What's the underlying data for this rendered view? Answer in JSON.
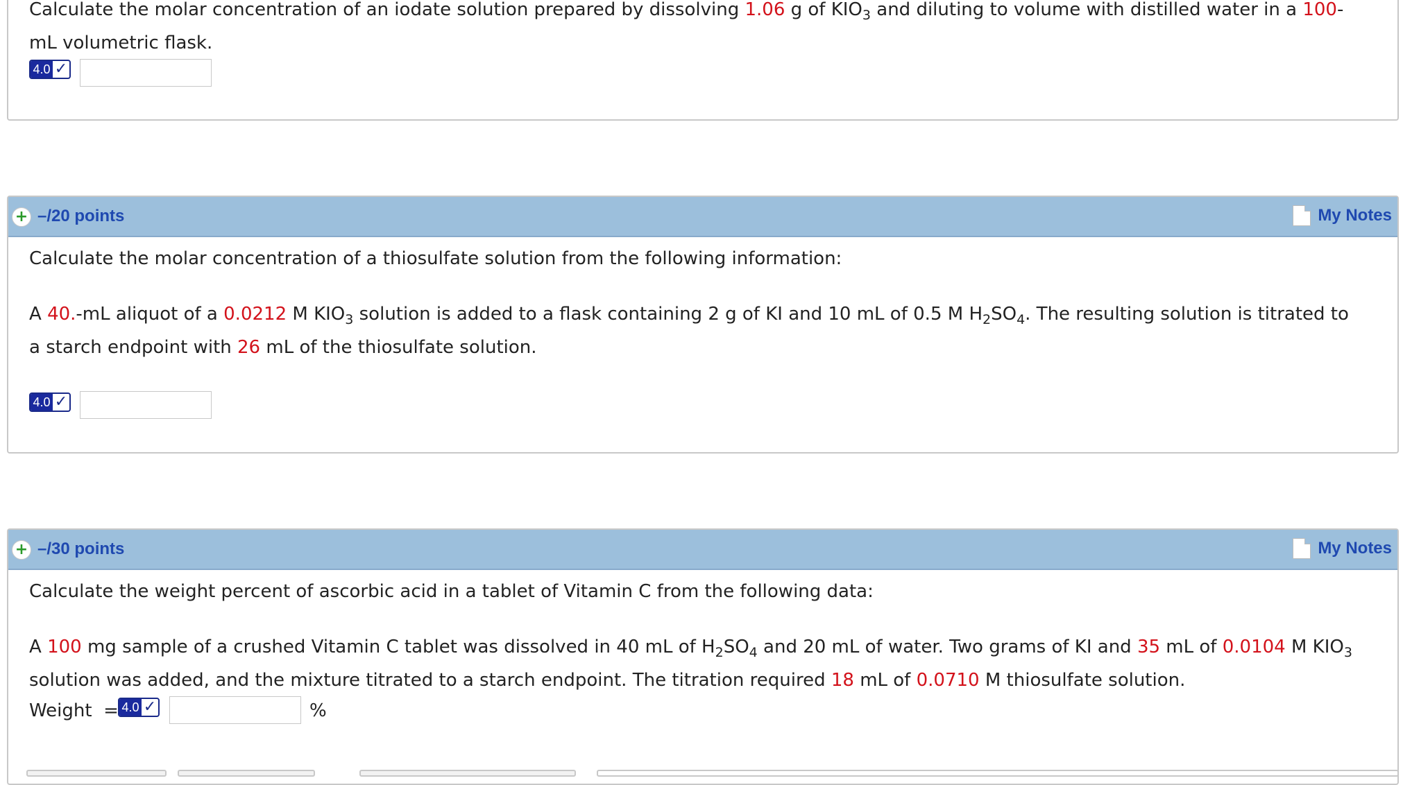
{
  "q1": {
    "line1": [
      {
        "t": "Calculate the molar concentration of an iodate solution prepared by dissolving ",
        "r": false
      },
      {
        "t": "1.06",
        "r": true
      },
      {
        "t": " g of KIO",
        "r": false
      },
      {
        "t": "3",
        "sub": true
      },
      {
        "t": " and diluting to volume with distilled water in a ",
        "r": false
      },
      {
        "t": "100",
        "r": true
      },
      {
        "t": "-",
        "r": false
      }
    ],
    "line2": "mL volumetric flask.",
    "badge": "4.0",
    "check": "✓"
  },
  "q2": {
    "points": "–/20 points",
    "notes": "My Notes",
    "intro": "Calculate the molar concentration of a thiosulfate solution from the following information:",
    "line1": [
      {
        "t": "A ",
        "r": false
      },
      {
        "t": "40.",
        "r": true
      },
      {
        "t": "-mL aliquot of a ",
        "r": false
      },
      {
        "t": "0.0212",
        "r": true
      },
      {
        "t": " M KIO",
        "r": false
      },
      {
        "t": "3",
        "sub": true
      },
      {
        "t": " solution is added to a flask containing 2 g of KI and 10 mL of 0.5 M H",
        "r": false
      },
      {
        "t": "2",
        "sub": true
      },
      {
        "t": "SO",
        "r": false
      },
      {
        "t": "4",
        "sub": true
      },
      {
        "t": ". The resulting solution is titrated to",
        "r": false
      }
    ],
    "line2": [
      {
        "t": "a starch endpoint with ",
        "r": false
      },
      {
        "t": "26",
        "r": true
      },
      {
        "t": " mL of the thiosulfate solution.",
        "r": false
      }
    ],
    "badge": "4.0",
    "check": "✓"
  },
  "q3": {
    "points": "–/30 points",
    "notes": "My Notes",
    "intro": "Calculate the weight percent of ascorbic acid in a tablet of Vitamin C from the following data:",
    "line1": [
      {
        "t": "A ",
        "r": false
      },
      {
        "t": "100",
        "r": true
      },
      {
        "t": " mg sample of a crushed Vitamin C tablet was dissolved in 40 mL of H",
        "r": false
      },
      {
        "t": "2",
        "sub": true
      },
      {
        "t": "SO",
        "r": false
      },
      {
        "t": "4",
        "sub": true
      },
      {
        "t": " and 20 mL of water. Two grams of KI and ",
        "r": false
      },
      {
        "t": "35",
        "r": true
      },
      {
        "t": " mL of ",
        "r": false
      },
      {
        "t": "0.0104",
        "r": true
      },
      {
        "t": " M KIO",
        "r": false
      },
      {
        "t": "3",
        "sub": true
      }
    ],
    "line2": [
      {
        "t": "solution was added, and the mixture titrated to a starch endpoint. The titration required ",
        "r": false
      },
      {
        "t": "18",
        "r": true
      },
      {
        "t": " mL of ",
        "r": false
      },
      {
        "t": "0.0710",
        "r": true
      },
      {
        "t": " M thiosulfate solution.",
        "r": false
      }
    ],
    "weight_label": "Weight  =",
    "unit": "%",
    "badge": "4.0",
    "check": "✓"
  },
  "icons": {
    "expand": "+"
  }
}
